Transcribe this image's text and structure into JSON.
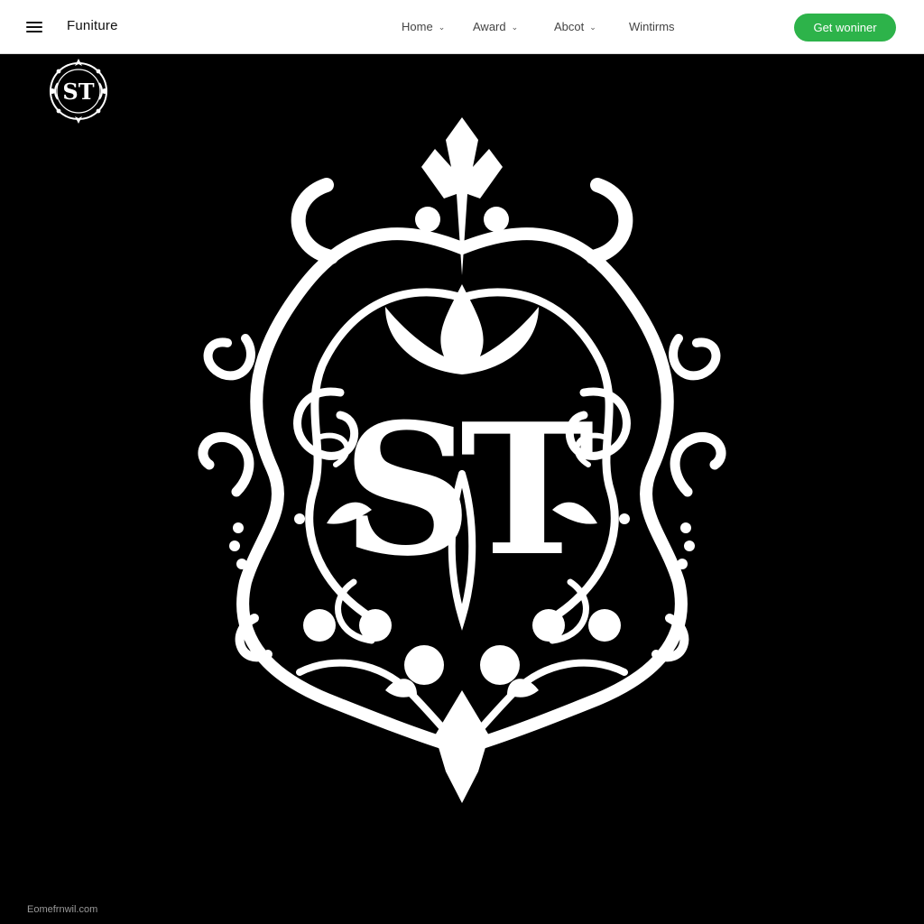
{
  "header": {
    "menu_icon": "hamburger-menu-icon",
    "brand": "Funiture",
    "nav": [
      {
        "label": "Home",
        "has_dropdown": true
      },
      {
        "label": "Award",
        "has_dropdown": true
      },
      {
        "label": "Abcot",
        "has_dropdown": true
      },
      {
        "label": "Wintirms",
        "has_dropdown": false
      }
    ],
    "cta_label": "Get woniner",
    "cta_color": "#2db34a",
    "dropdown_icon": "chevron-down-icon"
  },
  "hero": {
    "background_color": "#000000",
    "small_logo": {
      "text": "ST",
      "icon": "ornate-monogram-icon"
    },
    "emblem": {
      "monogram": "ST",
      "icon": "baroque-ornament-emblem"
    }
  },
  "footer": {
    "text": "Eomefrnwil.com"
  }
}
